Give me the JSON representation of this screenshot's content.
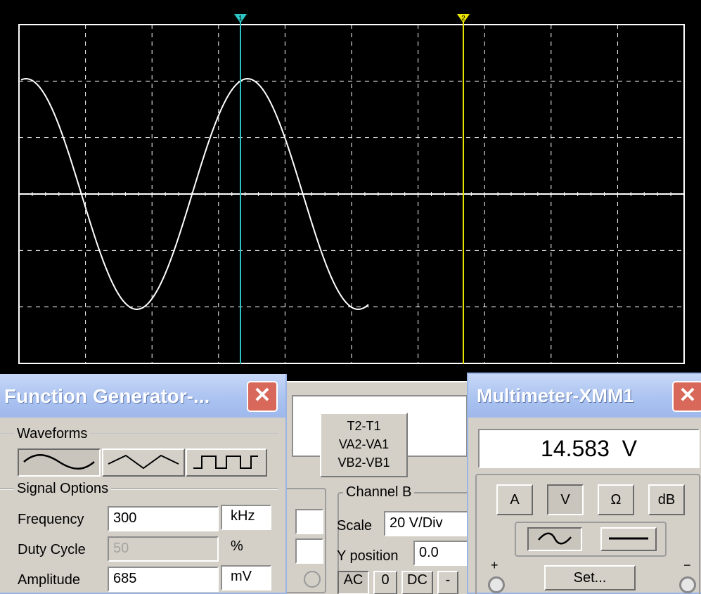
{
  "oscilloscope": {
    "cursor_labels": [
      "1",
      "2"
    ],
    "colors": {
      "background": "#000000",
      "grid": "#ffffff",
      "trace": "#ffffff",
      "cursor1": "#2ec4c4",
      "cursor2": "#e8e400"
    }
  },
  "function_generator": {
    "title": "Function Generator-...",
    "waveforms_label": "Waveforms",
    "waveform_icons": [
      "sine-wave-icon",
      "triangle-wave-icon",
      "square-wave-icon"
    ],
    "signal_options_label": "Signal Options",
    "fields": [
      {
        "label": "Frequency",
        "value": "300",
        "unit": "kHz"
      },
      {
        "label": "Duty Cycle",
        "value": "50",
        "unit": "%"
      },
      {
        "label": "Amplitude",
        "value": "685",
        "unit": "mV"
      }
    ]
  },
  "scope_panel": {
    "measure_lines": [
      "T2-T1",
      "VA2-VA1",
      "VB2-VB1"
    ],
    "channel_b": {
      "title": "Channel B",
      "scale_label": "Scale",
      "scale_value": "20 V/Div",
      "ypos_label": "Y position",
      "ypos_value": "0.0",
      "coupling": [
        "AC",
        "0",
        "DC",
        "-"
      ]
    }
  },
  "multimeter": {
    "title": "Multimeter-XMM1",
    "reading": "14.583  V",
    "mode_buttons": [
      "A",
      "V",
      "Ω",
      "dB"
    ],
    "set_label": "Set...",
    "plus_label": "+",
    "minus_label": "−"
  }
}
